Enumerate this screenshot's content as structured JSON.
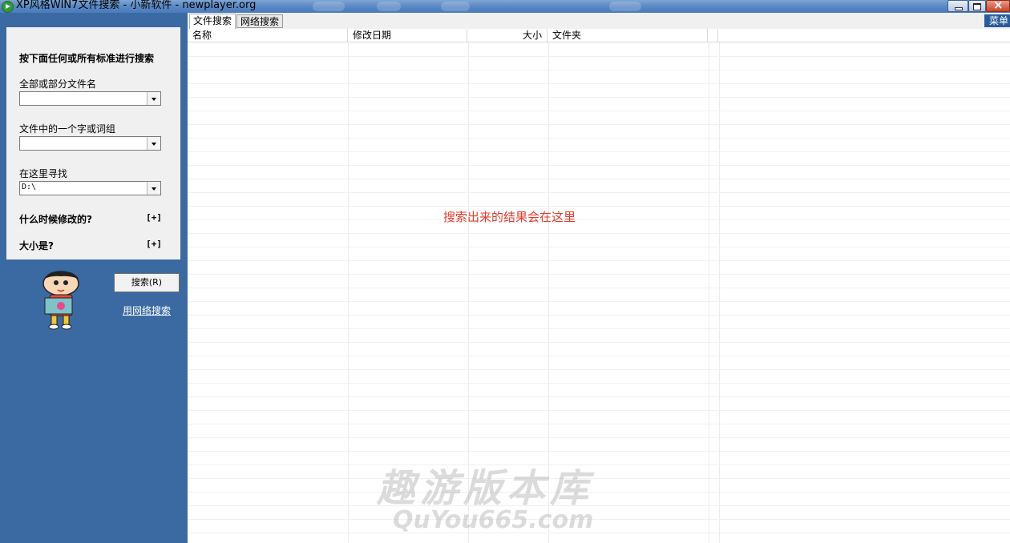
{
  "window": {
    "title": "XP风格WIN7文件搜索 - 小新软件 - newplayer.org"
  },
  "left_panel": {
    "heading": "按下面任何或所有标准进行搜索",
    "filename_label": "全部或部分文件名",
    "filename_value": "",
    "word_label": "文件中的一个字或词组",
    "word_value": "",
    "lookin_label": "在这里寻找",
    "lookin_value": "D:\\",
    "modified_label": "什么时候修改的?",
    "modified_toggle": "[+]",
    "size_label": "大小是?",
    "size_toggle": "[+]",
    "search_button": "搜索(R)",
    "web_search_link": "用网络搜索"
  },
  "tabs": {
    "file_search": "文件搜索",
    "web_search": "网络搜索",
    "menu": "菜单"
  },
  "columns": [
    "名称",
    "修改日期",
    "大小",
    "文件夹"
  ],
  "results_placeholder": "搜索出来的结果会在这里",
  "watermark": {
    "line1": "趣游版本库",
    "line2": "QuYou665.com"
  },
  "colors": {
    "panel_bg": "#3b6aa2",
    "placeholder_text": "#e03c2e"
  }
}
